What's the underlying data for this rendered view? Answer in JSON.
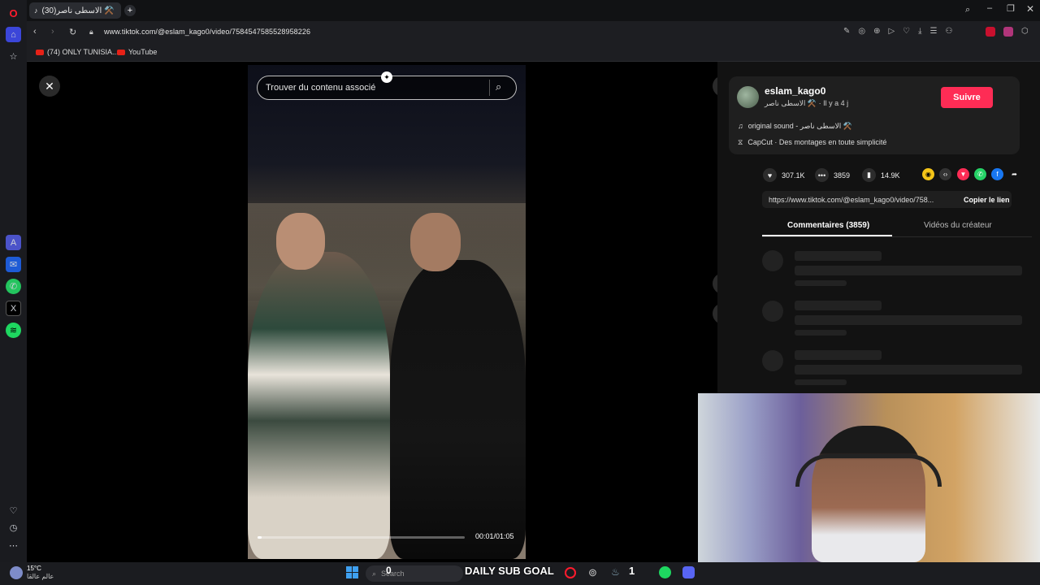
{
  "browser": {
    "tab_title": "(30)الاسطى ناصر ⚒️",
    "url": "www.tiktok.com/@eslam_kago0/video/7584547585528958226",
    "bookmarks": [
      {
        "label": "(74) ONLY TUNISIA..."
      },
      {
        "label": "YouTube"
      }
    ]
  },
  "player": {
    "search_placeholder": "Trouver du contenu associé",
    "time": "00:01/01:05",
    "progress": 0.02
  },
  "creator": {
    "username": "eslam_kago0",
    "subtitle": "الاسطى ناصر ⚒️ · Il y a 4 j",
    "follow_label": "Suivre",
    "sound": "original sound - الاسطى ناصر ⚒️",
    "capcut": "CapCut · Des montages en toute simplicité"
  },
  "stats": {
    "likes": "307.1K",
    "comments": "3859",
    "saves": "14.9K"
  },
  "share": {
    "link": "https://www.tiktok.com/@eslam_kago0/video/758...",
    "copy_label": "Copier le lien"
  },
  "tabs": {
    "comments": "Commentaires (3859)",
    "creator_videos": "Vidéos du créateur"
  },
  "taskbar": {
    "weather_temp": "15°C",
    "weather_loc": "عالم عالقا",
    "search": "Search",
    "search_count": "0",
    "sub_goal": "DAILY SUB GOAL",
    "sub_count": "1"
  },
  "colors": {
    "accent_follow": "#fe2c55",
    "opera_red": "#ff1b2d"
  }
}
